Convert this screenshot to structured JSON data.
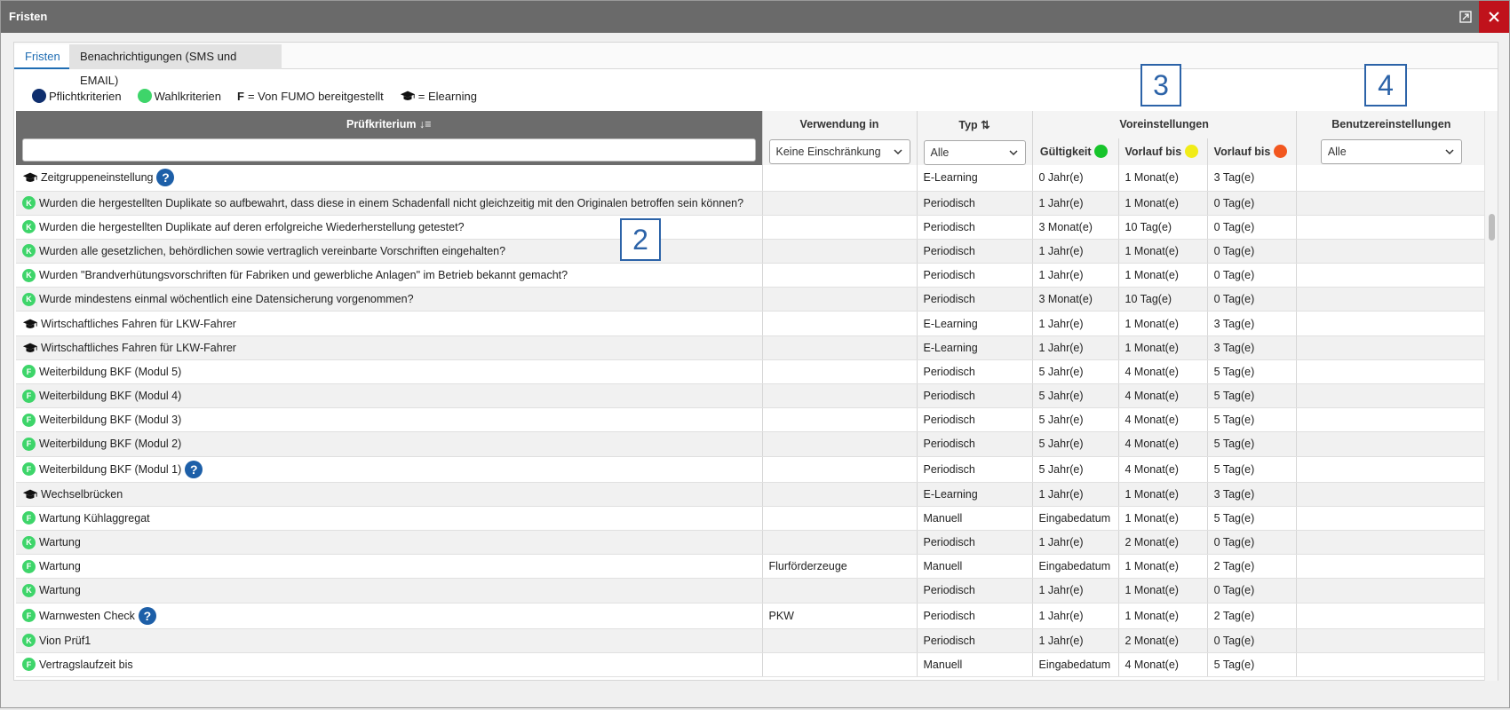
{
  "window": {
    "title": "Fristen"
  },
  "tabs": [
    {
      "label": "Fristen"
    },
    {
      "label": "Benachrichtigungen (SMS und EMAIL)"
    }
  ],
  "legend": {
    "pflicht": "Pflichtkriterien",
    "wahl": "Wahlkriterien",
    "f_key": "F",
    "f_text": "= Von FUMO bereitgestellt",
    "elearning": "= Elearning"
  },
  "colors": {
    "pflicht": "#0f2f6e",
    "wahl": "#3ed56a",
    "green": "#17c42b",
    "yellow": "#f1ec18",
    "orange": "#f2571f"
  },
  "annotations": [
    "2",
    "3",
    "4"
  ],
  "table": {
    "headers": {
      "kriterium": "Prüfkriterium ↓≡",
      "verwendung": "Verwendung in",
      "typ": "Typ ⇅",
      "voreinstellungen": "Voreinstellungen",
      "benutzer": "Benutzereinstellungen",
      "gueltigkeit": "Gültigkeit",
      "vorlauf1": "Vorlauf bis",
      "vorlauf2": "Vorlauf bis"
    },
    "filters": {
      "verwendung": "Keine Einschränkung",
      "typ": "Alle",
      "benutzer": "Alle"
    },
    "rows": [
      {
        "icon": "cap",
        "badge": "",
        "name": "Zeitgruppeneinstellung",
        "help": "?",
        "verwendung": "",
        "typ": "E-Learning",
        "gueltigkeit": "0 Jahr(e)",
        "vorlauf1": "1 Monat(e)",
        "vorlauf2": "3 Tag(e)"
      },
      {
        "icon": "badge",
        "badge": "K",
        "name": "Wurden die hergestellten Duplikate so aufbewahrt, dass diese in einem Schadenfall nicht gleichzeitig mit den Originalen betroffen sein können?",
        "help": "",
        "verwendung": "",
        "typ": "Periodisch",
        "gueltigkeit": "1 Jahr(e)",
        "vorlauf1": "1 Monat(e)",
        "vorlauf2": "0 Tag(e)"
      },
      {
        "icon": "badge",
        "badge": "K",
        "name": "Wurden die hergestellten Duplikate auf deren erfolgreiche Wiederherstellung getestet?",
        "help": "",
        "verwendung": "",
        "typ": "Periodisch",
        "gueltigkeit": "3 Monat(e)",
        "vorlauf1": "10 Tag(e)",
        "vorlauf2": "0 Tag(e)"
      },
      {
        "icon": "badge",
        "badge": "K",
        "name": "Wurden alle gesetzlichen, behördlichen sowie vertraglich vereinbarte Vorschriften eingehalten?",
        "help": "",
        "verwendung": "",
        "typ": "Periodisch",
        "gueltigkeit": "1 Jahr(e)",
        "vorlauf1": "1 Monat(e)",
        "vorlauf2": "0 Tag(e)"
      },
      {
        "icon": "badge",
        "badge": "K",
        "name": "Wurden \"Brandverhütungsvorschriften für Fabriken und gewerbliche Anlagen\" im Betrieb bekannt gemacht?",
        "help": "",
        "verwendung": "",
        "typ": "Periodisch",
        "gueltigkeit": "1 Jahr(e)",
        "vorlauf1": "1 Monat(e)",
        "vorlauf2": "0 Tag(e)"
      },
      {
        "icon": "badge",
        "badge": "K",
        "name": "Wurde mindestens einmal wöchentlich eine Datensicherung vorgenommen?",
        "help": "",
        "verwendung": "",
        "typ": "Periodisch",
        "gueltigkeit": "3 Monat(e)",
        "vorlauf1": "10 Tag(e)",
        "vorlauf2": "0 Tag(e)"
      },
      {
        "icon": "cap",
        "badge": "",
        "name": "Wirtschaftliches Fahren für LKW-Fahrer",
        "help": "",
        "verwendung": "",
        "typ": "E-Learning",
        "gueltigkeit": "1 Jahr(e)",
        "vorlauf1": "1 Monat(e)",
        "vorlauf2": "3 Tag(e)"
      },
      {
        "icon": "cap",
        "badge": "",
        "name": "Wirtschaftliches Fahren für LKW-Fahrer",
        "help": "",
        "verwendung": "",
        "typ": "E-Learning",
        "gueltigkeit": "1 Jahr(e)",
        "vorlauf1": "1 Monat(e)",
        "vorlauf2": "3 Tag(e)"
      },
      {
        "icon": "badge",
        "badge": "F",
        "name": "Weiterbildung BKF (Modul 5)",
        "help": "",
        "verwendung": "",
        "typ": "Periodisch",
        "gueltigkeit": "5 Jahr(e)",
        "vorlauf1": "4 Monat(e)",
        "vorlauf2": "5 Tag(e)"
      },
      {
        "icon": "badge",
        "badge": "F",
        "name": "Weiterbildung BKF (Modul 4)",
        "help": "",
        "verwendung": "",
        "typ": "Periodisch",
        "gueltigkeit": "5 Jahr(e)",
        "vorlauf1": "4 Monat(e)",
        "vorlauf2": "5 Tag(e)"
      },
      {
        "icon": "badge",
        "badge": "F",
        "name": "Weiterbildung BKF (Modul 3)",
        "help": "",
        "verwendung": "",
        "typ": "Periodisch",
        "gueltigkeit": "5 Jahr(e)",
        "vorlauf1": "4 Monat(e)",
        "vorlauf2": "5 Tag(e)"
      },
      {
        "icon": "badge",
        "badge": "F",
        "name": "Weiterbildung BKF (Modul 2)",
        "help": "",
        "verwendung": "",
        "typ": "Periodisch",
        "gueltigkeit": "5 Jahr(e)",
        "vorlauf1": "4 Monat(e)",
        "vorlauf2": "5 Tag(e)"
      },
      {
        "icon": "badge",
        "badge": "F",
        "name": "Weiterbildung BKF (Modul 1)",
        "help": "?",
        "verwendung": "",
        "typ": "Periodisch",
        "gueltigkeit": "5 Jahr(e)",
        "vorlauf1": "4 Monat(e)",
        "vorlauf2": "5 Tag(e)"
      },
      {
        "icon": "cap",
        "badge": "",
        "name": "Wechselbrücken",
        "help": "",
        "verwendung": "",
        "typ": "E-Learning",
        "gueltigkeit": "1 Jahr(e)",
        "vorlauf1": "1 Monat(e)",
        "vorlauf2": "3 Tag(e)"
      },
      {
        "icon": "badge",
        "badge": "F",
        "name": "Wartung Kühlaggregat",
        "help": "",
        "verwendung": "",
        "typ": "Manuell",
        "gueltigkeit": "Eingabedatum",
        "vorlauf1": "1 Monat(e)",
        "vorlauf2": "5 Tag(e)"
      },
      {
        "icon": "badge",
        "badge": "K",
        "name": "Wartung",
        "help": "",
        "verwendung": "",
        "typ": "Periodisch",
        "gueltigkeit": "1 Jahr(e)",
        "vorlauf1": "2 Monat(e)",
        "vorlauf2": "0 Tag(e)"
      },
      {
        "icon": "badge",
        "badge": "F",
        "name": "Wartung",
        "help": "",
        "verwendung": "Flurförderzeuge",
        "typ": "Manuell",
        "gueltigkeit": "Eingabedatum",
        "vorlauf1": "1 Monat(e)",
        "vorlauf2": "2 Tag(e)"
      },
      {
        "icon": "badge",
        "badge": "K",
        "name": "Wartung",
        "help": "",
        "verwendung": "",
        "typ": "Periodisch",
        "gueltigkeit": "1 Jahr(e)",
        "vorlauf1": "1 Monat(e)",
        "vorlauf2": "0 Tag(e)"
      },
      {
        "icon": "badge",
        "badge": "F",
        "name": "Warnwesten Check",
        "help": "?",
        "verwendung": "PKW",
        "typ": "Periodisch",
        "gueltigkeit": "1 Jahr(e)",
        "vorlauf1": "1 Monat(e)",
        "vorlauf2": "2 Tag(e)"
      },
      {
        "icon": "badge",
        "badge": "K",
        "name": "Vion Prüf1",
        "help": "",
        "verwendung": "",
        "typ": "Periodisch",
        "gueltigkeit": "1 Jahr(e)",
        "vorlauf1": "2 Monat(e)",
        "vorlauf2": "0 Tag(e)"
      },
      {
        "icon": "badge",
        "badge": "F",
        "name": "Vertragslaufzeit bis",
        "help": "",
        "verwendung": "",
        "typ": "Manuell",
        "gueltigkeit": "Eingabedatum",
        "vorlauf1": "4 Monat(e)",
        "vorlauf2": "5 Tag(e)"
      }
    ]
  }
}
